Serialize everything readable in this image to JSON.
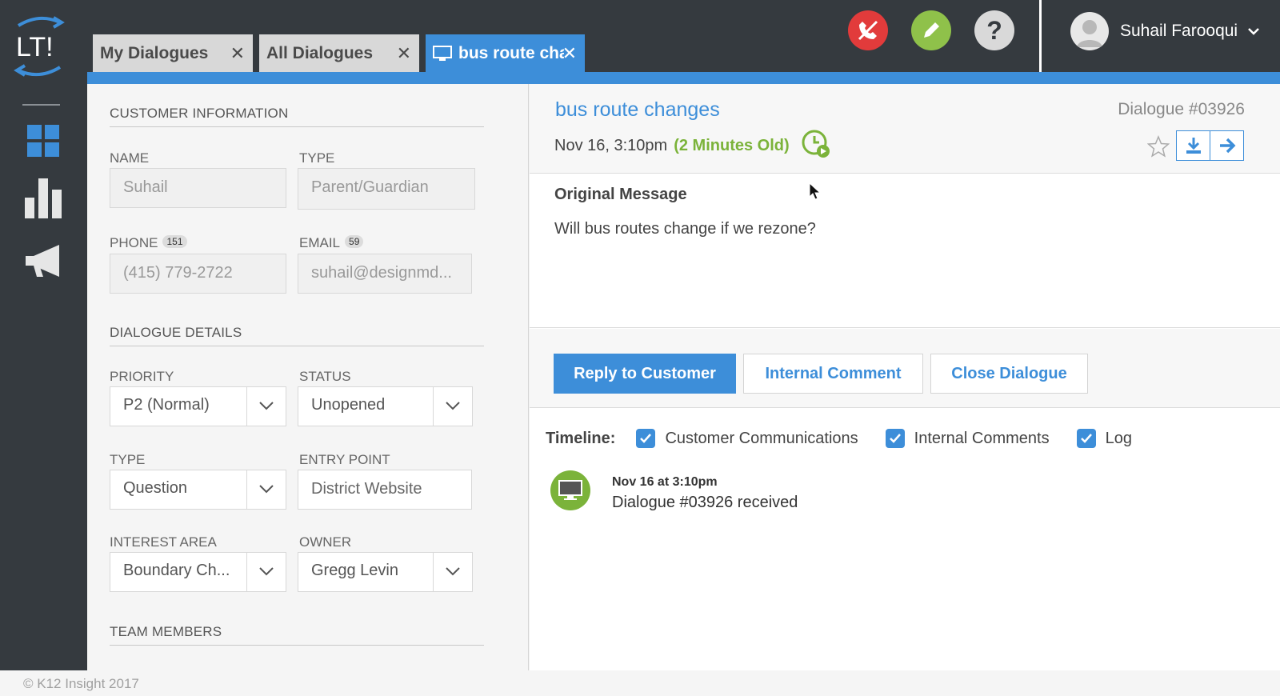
{
  "colors": {
    "sidebar_bg": "#353a3f",
    "accent_blue": "#3d8ed9",
    "hangup_red": "#e23b3b",
    "edit_green": "#8fc14a",
    "help_gray": "#d9d9d9",
    "age_green": "#7bb33a"
  },
  "logo": {
    "text": "LT!"
  },
  "sidebar": {
    "items": [
      {
        "name": "dashboard",
        "icon": "grid-icon"
      },
      {
        "name": "reports",
        "icon": "bar-chart-icon"
      },
      {
        "name": "announcements",
        "icon": "megaphone-icon"
      }
    ]
  },
  "tabs": [
    {
      "label": "My Dialogues",
      "close": "✕",
      "active": false
    },
    {
      "label": "All Dialogues",
      "close": "✕",
      "active": false
    },
    {
      "label": "bus route changes",
      "close": "✕",
      "active": true,
      "icon": "monitor-icon"
    }
  ],
  "toolbar": {
    "buttons": [
      {
        "name": "hangup",
        "icon": "phone-hangup-icon"
      },
      {
        "name": "edit",
        "icon": "pencil-icon"
      },
      {
        "name": "help",
        "icon": "question-icon",
        "text": "?"
      }
    ]
  },
  "user": {
    "name": "Suhail Farooqui",
    "icon": "avatar-icon"
  },
  "customer": {
    "section_title": "CUSTOMER INFORMATION",
    "name_label": "NAME",
    "name_value": "Suhail",
    "type_label": "TYPE",
    "type_value": "Parent/Guardian",
    "phone_label": "PHONE",
    "phone_badge": "151",
    "phone_value": "(415) 779-2722",
    "email_label": "EMAIL",
    "email_badge": "59",
    "email_value": "suhail@designmd..."
  },
  "details": {
    "section_title": "DIALOGUE DETAILS",
    "priority_label": "PRIORITY",
    "priority_value": "P2 (Normal)",
    "status_label": "STATUS",
    "status_value": "Unopened",
    "type_label": "TYPE",
    "type_value": "Question",
    "entry_label": "ENTRY POINT",
    "entry_value": "District Website",
    "interest_label": "INTEREST AREA",
    "interest_value": "Boundary Ch...",
    "owner_label": "OWNER",
    "owner_value": "Gregg Levin"
  },
  "team": {
    "section_title": "TEAM MEMBERS"
  },
  "dialogue": {
    "title": "bus route changes",
    "date": "Nov 16, 3:10pm",
    "age": "(2 Minutes Old)",
    "number": "Dialogue #03926",
    "original_title": "Original Message",
    "original_text": "Will bus routes change if we rezone?"
  },
  "actions": {
    "reply": "Reply to Customer",
    "comment": "Internal Comment",
    "close": "Close Dialogue"
  },
  "timeline": {
    "label": "Timeline:",
    "filters": [
      {
        "label": "Customer Communications",
        "checked": true
      },
      {
        "label": "Internal Comments",
        "checked": true
      },
      {
        "label": "Log",
        "checked": true
      }
    ],
    "events": [
      {
        "time": "Nov 16 at 3:10pm",
        "text": "Dialogue #03926 received",
        "icon": "monitor-icon"
      }
    ]
  },
  "footer": {
    "copyright": "© K12 Insight 2017"
  }
}
